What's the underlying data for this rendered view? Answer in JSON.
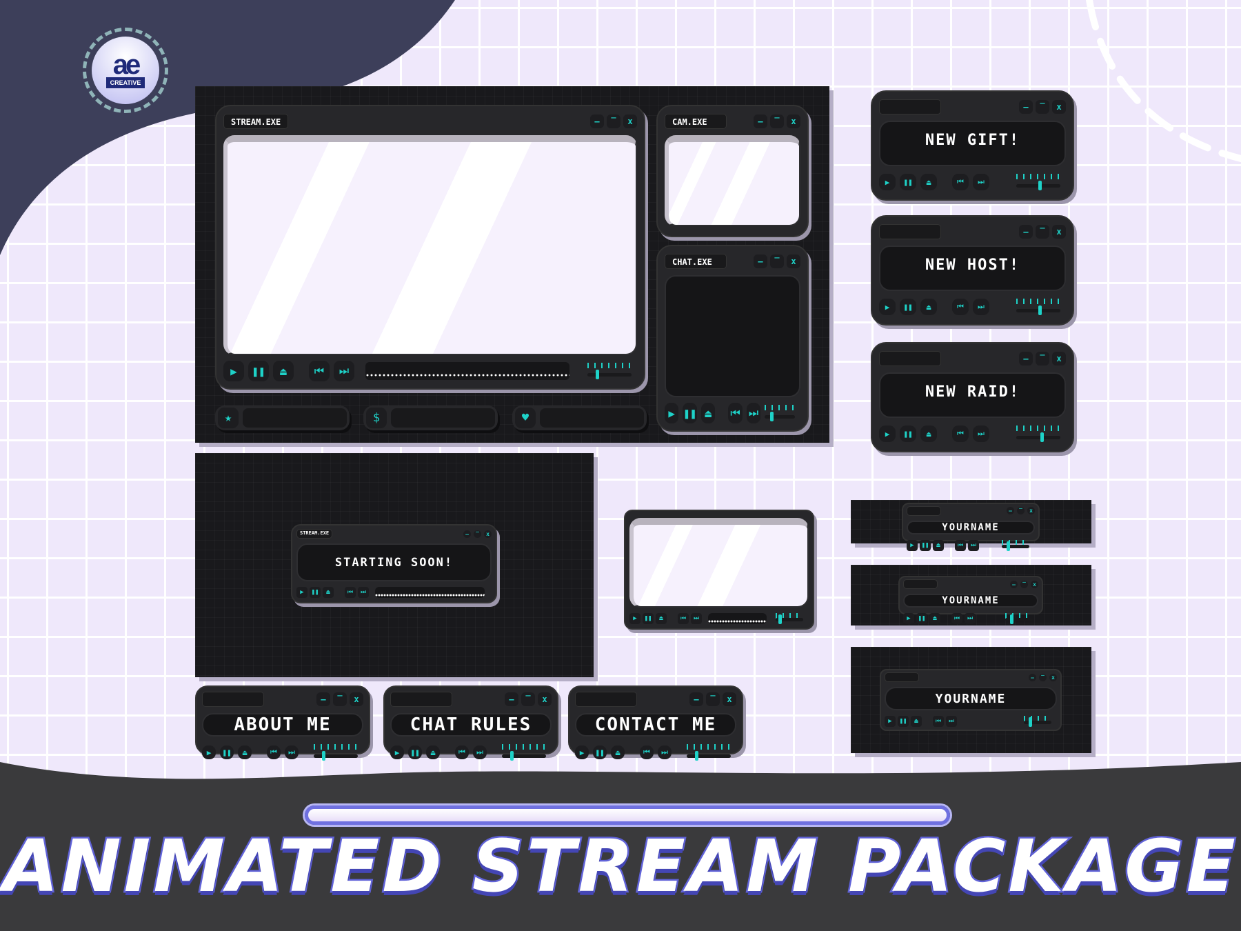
{
  "colors": {
    "accent": "#1ed2c8",
    "panel": "#19191c",
    "window": "#27272a",
    "background": "#efe8fb",
    "navy": "#3d3f5a",
    "title_outline": "#6062d8"
  },
  "logo": {
    "mark": "ae",
    "sub": "CREATIVE"
  },
  "window_buttons": {
    "minimize": "–",
    "maximize": "‾",
    "close": "x"
  },
  "controls": {
    "play": "▶",
    "pause": "❚❚",
    "eject": "⏏",
    "prev": "⏮",
    "next": "⏭"
  },
  "main_overlay": {
    "stream": {
      "title": "STREAM.EXE",
      "volume": 0.2
    },
    "cam": {
      "title": "CAM.EXE"
    },
    "chat": {
      "title": "CHAT.EXE"
    },
    "bars": [
      {
        "icon": "star-icon",
        "glyph": "★"
      },
      {
        "icon": "dollar-icon",
        "glyph": "$"
      },
      {
        "icon": "heart-icon",
        "glyph": "♥"
      }
    ]
  },
  "alerts": [
    {
      "text": "NEW GIFT!",
      "volume": 0.55
    },
    {
      "text": "NEW HOST!",
      "volume": 0.55
    },
    {
      "text": "NEW RAID!",
      "volume": 0.6
    }
  ],
  "starting_soon": {
    "window_title": "STREAM.EXE",
    "text": "STARTING SOON!"
  },
  "webcam": {
    "volume": 0.1
  },
  "panels": [
    {
      "text": "ABOUT ME"
    },
    {
      "text": "CHAT RULES"
    },
    {
      "text": "CONTACT ME"
    }
  ],
  "banners": [
    {
      "text": "YOURNAME"
    },
    {
      "text": "YOURNAME"
    },
    {
      "text": "YOURNAME"
    }
  ],
  "footer": {
    "title": "ANIMATED STREAM PACKAGE",
    "progress": 1.0
  }
}
